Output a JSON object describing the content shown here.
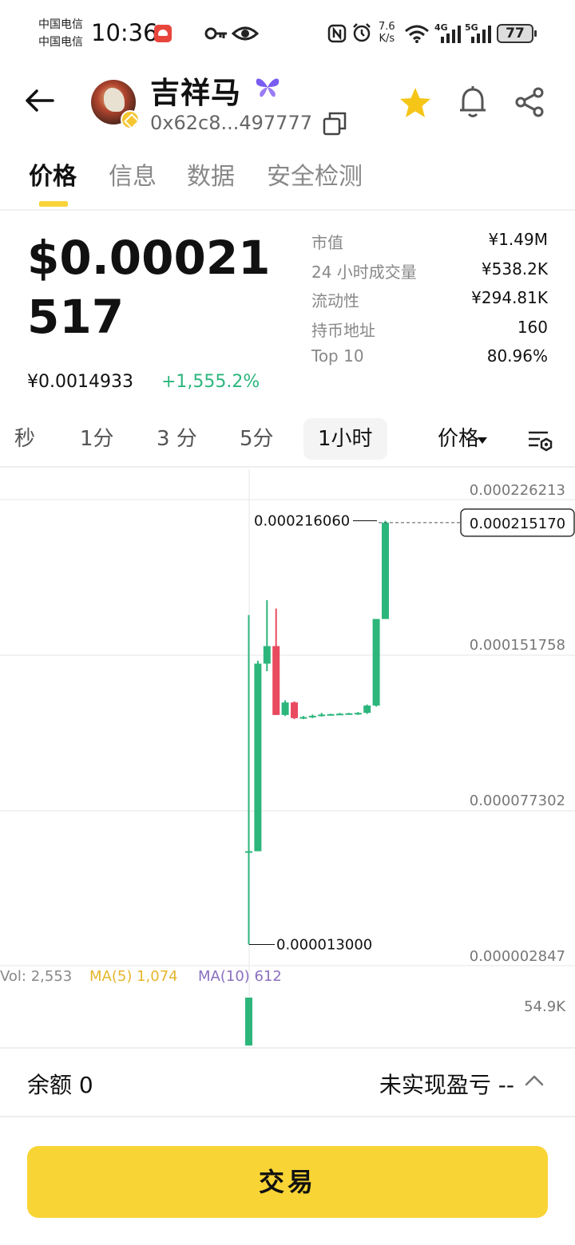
{
  "status_bar": {
    "carrier_1": "中国电信",
    "carrier_2": "中国电信",
    "time": "10:36",
    "net_speed_value": "7.6",
    "net_speed_unit": "K/s",
    "net_tag_1": "4G",
    "net_tag_2": "5G",
    "battery": "77"
  },
  "header": {
    "token_name": "吉祥马",
    "address": "0x62c8...497777"
  },
  "tabs": [
    "价格",
    "信息",
    "数据",
    "安全检测"
  ],
  "price": {
    "usd": "$0.00021517",
    "cny": "¥0.0014933",
    "change": "+1,555.2%"
  },
  "stats": [
    {
      "label": "市值",
      "value": "¥1.49M"
    },
    {
      "label": "24 小时成交量",
      "value": "¥538.2K"
    },
    {
      "label": "流动性",
      "value": "¥294.81K"
    },
    {
      "label": "持币地址",
      "value": "160"
    },
    {
      "label": "Top 10",
      "value": "80.96%"
    }
  ],
  "intervals": [
    "秒",
    "1分",
    "3 分",
    "5分",
    "1小时"
  ],
  "active_interval": "1小时",
  "metric_select": "价格",
  "chart_data": {
    "type": "candlestick",
    "y_axis_labels": [
      "0.000226213",
      "0.000151758",
      "0.000077302",
      "0.000002847"
    ],
    "ylim": [
      2.847e-06,
      0.000226213
    ],
    "current_price_label": "0.000215170",
    "current_price": 0.00021517,
    "high_label": "0.000216060",
    "high": 0.00021606,
    "low_label": "0.000013000",
    "low": 1.3e-05,
    "candles": [
      {
        "o": 5.77e-05,
        "h": 0.0001709,
        "l": 1.3e-05,
        "c": 5.77e-05
      },
      {
        "o": 5.77e-05,
        "h": 0.000149,
        "l": 5.77e-05,
        "c": 0.0001476
      },
      {
        "o": 0.0001476,
        "h": 0.000178,
        "l": 0.000144,
        "c": 0.000156
      },
      {
        "o": 0.000156,
        "h": 0.000174,
        "l": 0.000123,
        "c": 0.000123
      },
      {
        "o": 0.000123,
        "h": 0.00013,
        "l": 0.0001225,
        "c": 0.000129
      },
      {
        "o": 0.000129,
        "h": 0.0001295,
        "l": 0.000121,
        "c": 0.0001215
      },
      {
        "o": 0.0001215,
        "h": 0.0001225,
        "l": 0.000121,
        "c": 0.000122
      },
      {
        "o": 0.0001222,
        "h": 0.0001232,
        "l": 0.0001215,
        "c": 0.0001226
      },
      {
        "o": 0.0001226,
        "h": 0.000124,
        "l": 0.0001222,
        "c": 0.0001232
      },
      {
        "o": 0.0001232,
        "h": 0.0001236,
        "l": 0.0001228,
        "c": 0.0001234
      },
      {
        "o": 0.0001234,
        "h": 0.000124,
        "l": 0.000123,
        "c": 0.0001236
      },
      {
        "o": 0.0001236,
        "h": 0.000124,
        "l": 0.0001232,
        "c": 0.0001238
      },
      {
        "o": 0.0001236,
        "h": 0.0001244,
        "l": 0.000123,
        "c": 0.000124
      },
      {
        "o": 0.000124,
        "h": 0.000128,
        "l": 0.0001235,
        "c": 0.0001275
      },
      {
        "o": 0.0001275,
        "h": 0.000169,
        "l": 0.000127,
        "c": 0.000169
      },
      {
        "o": 0.000169,
        "h": 0.00021606,
        "l": 0.000169,
        "c": 0.00021517
      }
    ],
    "volume": {
      "label": "Vol: 2,553",
      "ma5": "MA(5) 1,074",
      "ma10": "MA(10) 612",
      "max_label": "54.9K"
    },
    "colors": {
      "up": "#2db67c",
      "down": "#e84a5f",
      "grid": "#eeeeee",
      "ma5": "#e5b62b",
      "ma10": "#8a6fbf"
    }
  },
  "bottom": {
    "balance": "余额 0",
    "pnl": "未实现盈亏 --",
    "trade_button": "交易"
  },
  "colors": {
    "accent": "#f8d435",
    "positive": "#2db67c",
    "negative": "#e84a5f"
  }
}
